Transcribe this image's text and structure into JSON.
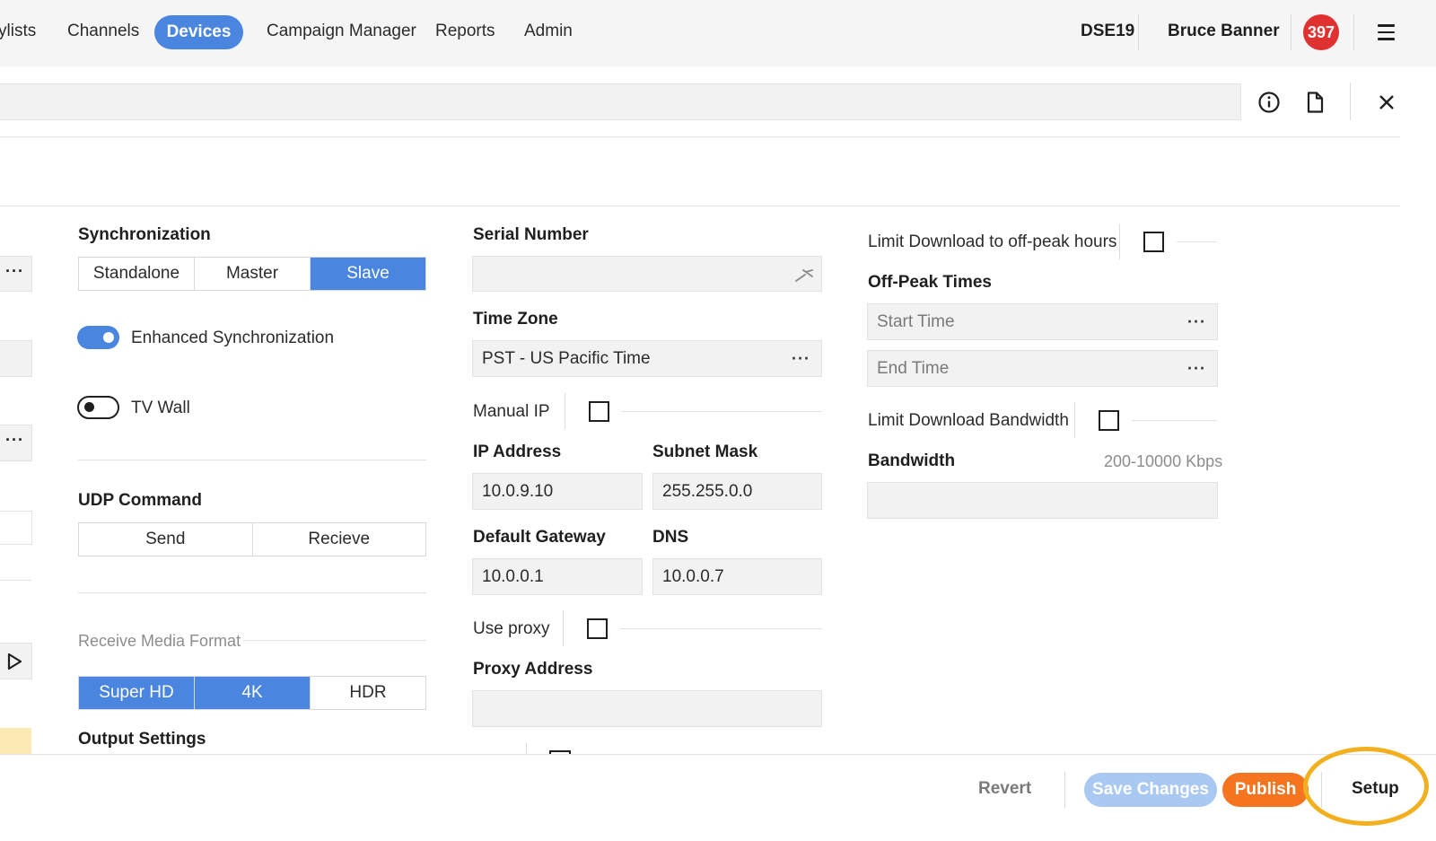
{
  "nav": {
    "items": [
      "ylists",
      "Channels",
      "Devices",
      "Campaign Manager",
      "Reports",
      "Admin"
    ],
    "active": "Devices",
    "org": "DSE19",
    "user": "Bruce Banner",
    "notification_count": "397"
  },
  "icons": {
    "info": "info-icon",
    "document": "document-icon",
    "close": "close-icon",
    "menu": "hamburger-menu-icon"
  },
  "sync": {
    "label": "Synchronization",
    "options": [
      "Standalone",
      "Master",
      "Slave"
    ],
    "selected": "Slave",
    "enhanced_label": "Enhanced Synchronization",
    "enhanced_on": true,
    "tvwall_label": "TV Wall",
    "tvwall_on": false
  },
  "udp": {
    "label": "UDP Command",
    "options": [
      "Send",
      "Recieve"
    ]
  },
  "media": {
    "label": "Receive Media Format",
    "options": [
      "Super HD",
      "4K",
      "HDR"
    ],
    "selected": [
      "Super HD",
      "4K"
    ]
  },
  "output": {
    "label": "Output Settings"
  },
  "serial": {
    "label": "Serial Number",
    "value": ""
  },
  "timezone": {
    "label": "Time Zone",
    "value": "PST - US Pacific Time"
  },
  "manual_ip": {
    "label": "Manual IP",
    "checked": false
  },
  "ip": {
    "label": "IP Address",
    "value": "10.0.9.10"
  },
  "subnet": {
    "label": "Subnet Mask",
    "value": "255.255.0.0"
  },
  "gateway": {
    "label": "Default Gateway",
    "value": "10.0.0.1"
  },
  "dns": {
    "label": "DNS",
    "value": "10.0.0.7"
  },
  "proxy": {
    "label": "Use proxy",
    "checked": false,
    "address_label": "Proxy Address",
    "address_value": ""
  },
  "offpeak": {
    "limit_label": "Limit Download to off-peak hours",
    "checked": false,
    "times_label": "Off-Peak Times",
    "start_placeholder": "Start Time",
    "end_placeholder": "End Time"
  },
  "bandwidth": {
    "limit_label": "Limit Download Bandwidth",
    "checked": false,
    "label": "Bandwidth",
    "hint": "200-10000 Kbps",
    "value": ""
  },
  "footer": {
    "revert": "Revert",
    "save": "Save Changes",
    "publish": "Publish",
    "setup": "Setup"
  },
  "colors": {
    "accent": "#4a86e0",
    "publish": "#f5741f",
    "badge": "#e03131",
    "highlight": "#f2b01e"
  }
}
